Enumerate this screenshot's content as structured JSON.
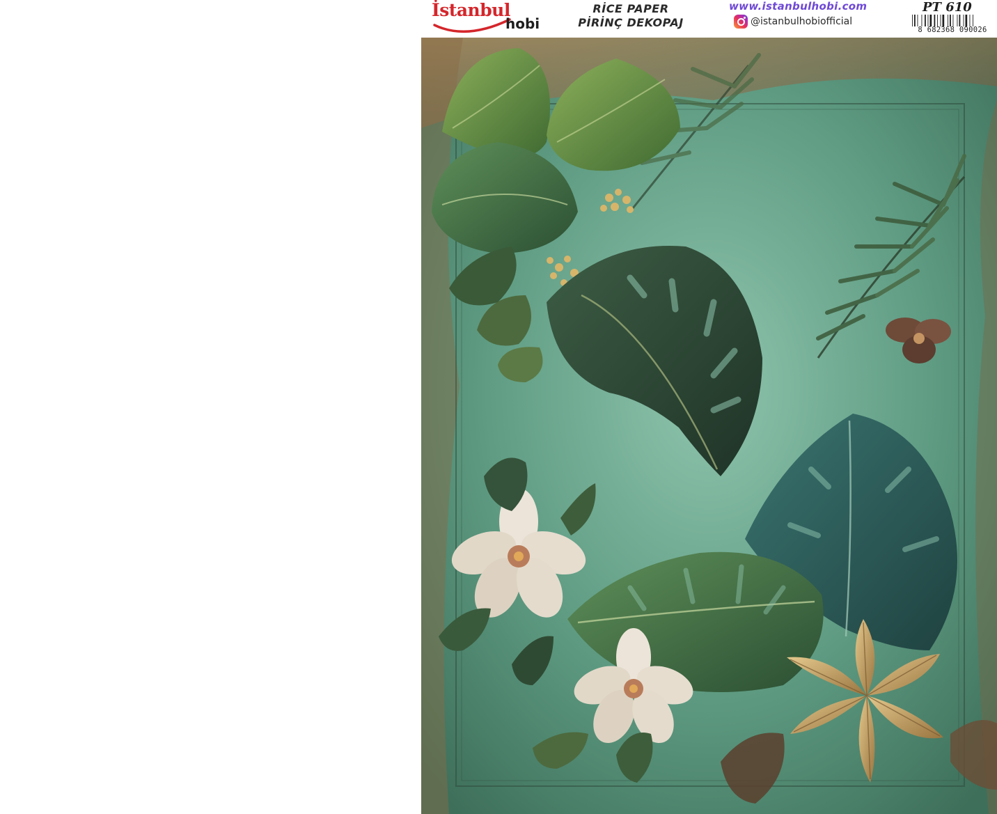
{
  "brand": {
    "logo_text": "İstanbul",
    "logo_subtext": "hobi"
  },
  "product": {
    "title_line1": "RİCE PAPER",
    "title_line2": "PİRİNÇ DEKOPAJ",
    "code": "PT 610"
  },
  "contact": {
    "website": "www.istanbulhobi.com",
    "instagram_handle": "@istanbulhobiofficial"
  },
  "barcode": {
    "number": "8 682368 090026"
  },
  "colors": {
    "brand_red": "#d4262b",
    "website_purple": "#6f49d6",
    "artwork_background": "#5f9c83",
    "leaf_dark": "#2c4a35",
    "leaf_light": "#6d9a4a",
    "flower_cream": "#ece4d8",
    "gold_leaf": "#c9a96a"
  },
  "artwork": {
    "subject": "tropical-foliage",
    "icons": [
      "monstera-leaf-icon",
      "palm-frond-icon",
      "white-flower-icon",
      "gold-leaf-icon"
    ]
  }
}
